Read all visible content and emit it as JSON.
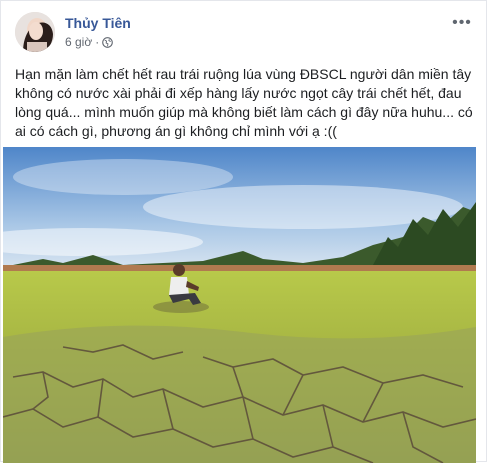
{
  "post": {
    "author": "Thủy Tiên",
    "time": "6 giờ",
    "separator": "·",
    "privacy_icon": "globe-icon",
    "more_icon": "more-options-icon",
    "text": "Hạn mặn làm chết hết rau trái ruộng lúa vùng ĐBSCL người dân miền tây không có nước xài phải đi xếp hàng lấy nước ngọt cây trái chết hết, đau lòng quá... mình muốn giúp mà không biết làm cách gì đây nữa huhu... có ai có cách gì, phương án gì không chỉ mình với ạ :((",
    "photo_description_icon": "drought-field-photo"
  },
  "colors": {
    "author": "#385898",
    "meta": "#616770",
    "text": "#1c1e21"
  }
}
